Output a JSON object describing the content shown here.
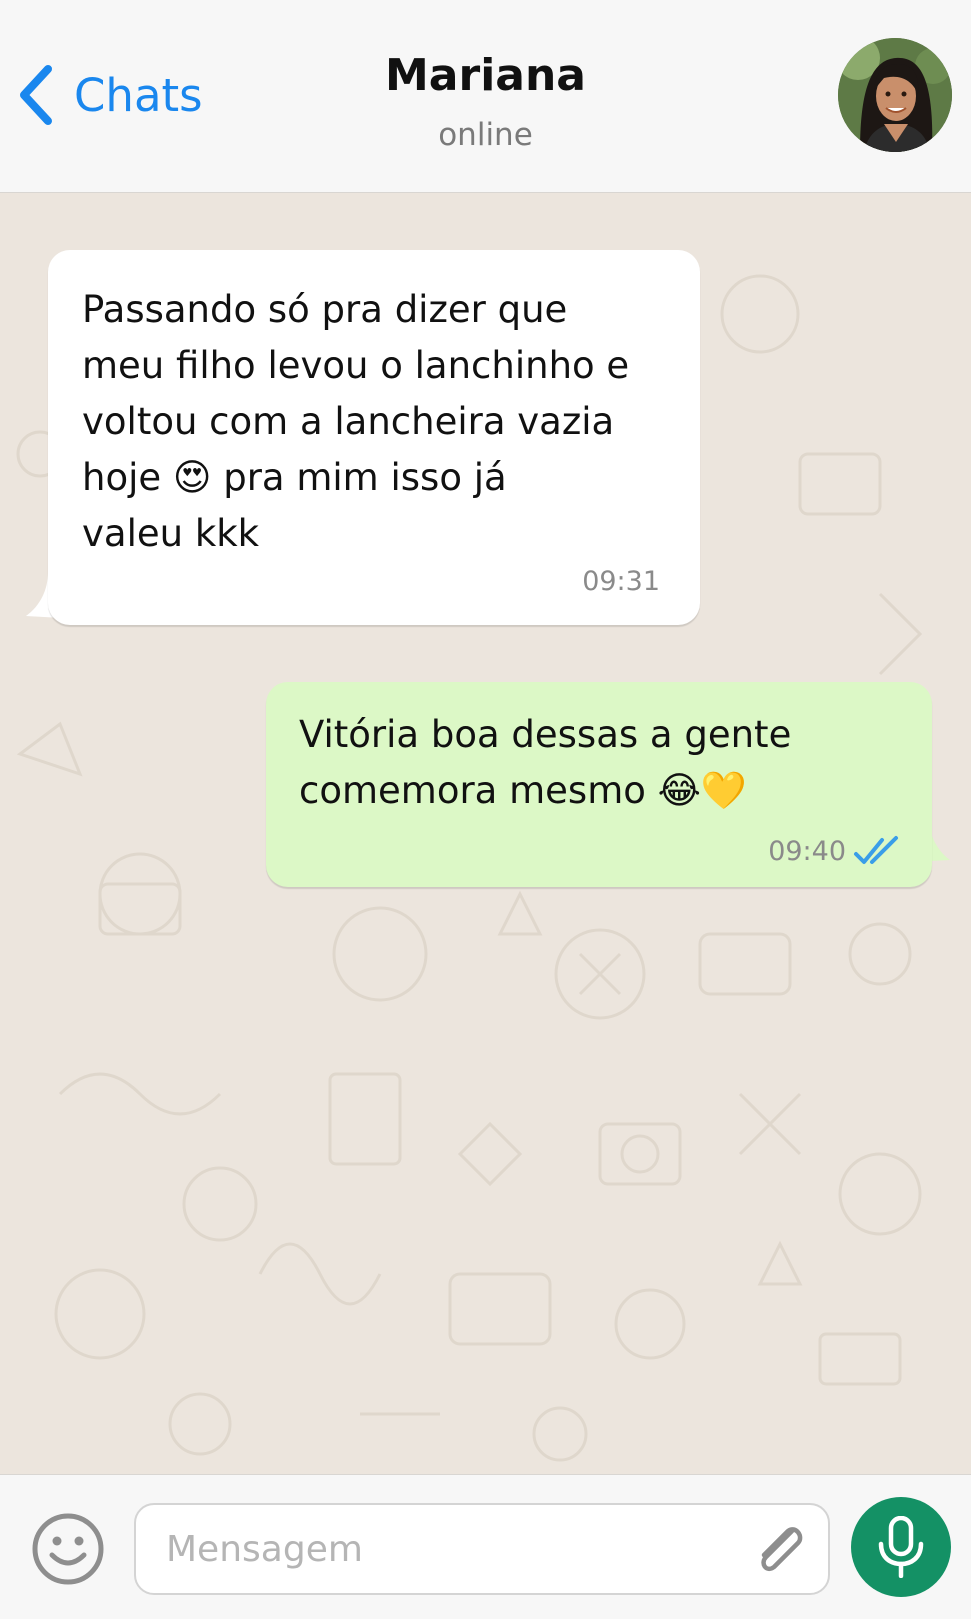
{
  "header": {
    "back_label": "Chats",
    "contact_name": "Mariana",
    "contact_status": "online"
  },
  "messages": [
    {
      "direction": "incoming",
      "text": "Passando só pra dizer que\nmeu filho levou o lanchinho e\nvoltou com a lancheira vazia\nhoje 😍 pra mim isso já\nvaleu kkk",
      "time": "09:31"
    },
    {
      "direction": "outgoing",
      "text": "Vitória boa dessas a gente\ncomemora mesmo 😂💛",
      "time": "09:40",
      "status_icon": "double-check-read-icon"
    }
  ],
  "composer": {
    "placeholder": "Mensagem",
    "value": ""
  },
  "icons": {
    "back": "chevron-left-icon",
    "emoji": "smiley-icon",
    "attach": "paperclip-icon",
    "send": "microphone-icon"
  },
  "colors": {
    "accent": "#1a87ee",
    "chat_background": "#ece5dd",
    "incoming_bubble": "#ffffff",
    "outgoing_bubble": "#dcf8c6",
    "read_ticks": "#3a9ee8",
    "mic_button": "#149165"
  }
}
